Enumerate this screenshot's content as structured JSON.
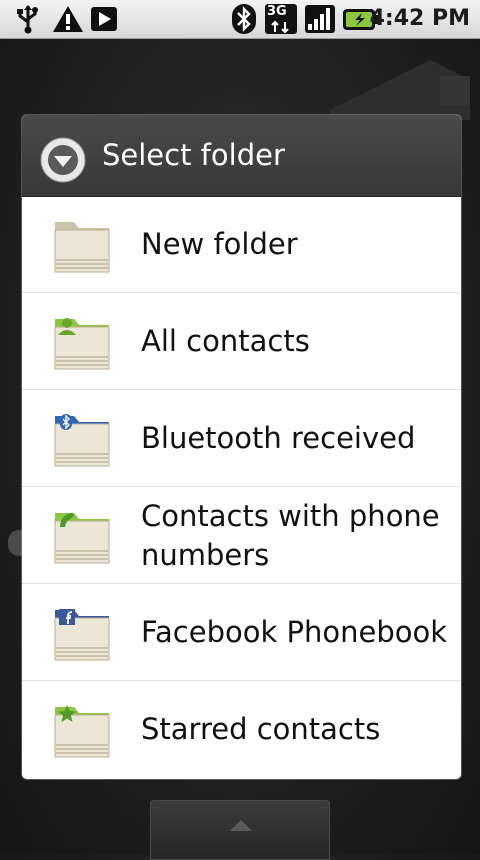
{
  "status_bar": {
    "icons": [
      "usb-icon",
      "warning-icon",
      "play-icon",
      "bluetooth-icon",
      "3g-icon",
      "signal-icon",
      "battery-charging-icon"
    ],
    "network_label": "3G",
    "time": "4:42 PM"
  },
  "dialog": {
    "title": "Select folder",
    "header_icon": "dropdown-arrow-icon",
    "items": [
      {
        "label": "New folder",
        "icon": "folder-icon"
      },
      {
        "label": "All contacts",
        "icon": "folder-contacts-icon"
      },
      {
        "label": "Bluetooth received",
        "icon": "folder-bluetooth-icon"
      },
      {
        "label": "Contacts with phone numbers",
        "icon": "folder-phone-icon"
      },
      {
        "label": "Facebook Phonebook",
        "icon": "folder-facebook-icon"
      },
      {
        "label": "Starred contacts",
        "icon": "folder-star-icon"
      }
    ]
  },
  "bottom_bar": {
    "icon": "chevron-up-icon"
  },
  "colors": {
    "accent_green": "#8dc63f",
    "bluetooth_blue": "#2f66b5",
    "facebook_blue": "#3b5998",
    "header_bg": "#404040"
  }
}
